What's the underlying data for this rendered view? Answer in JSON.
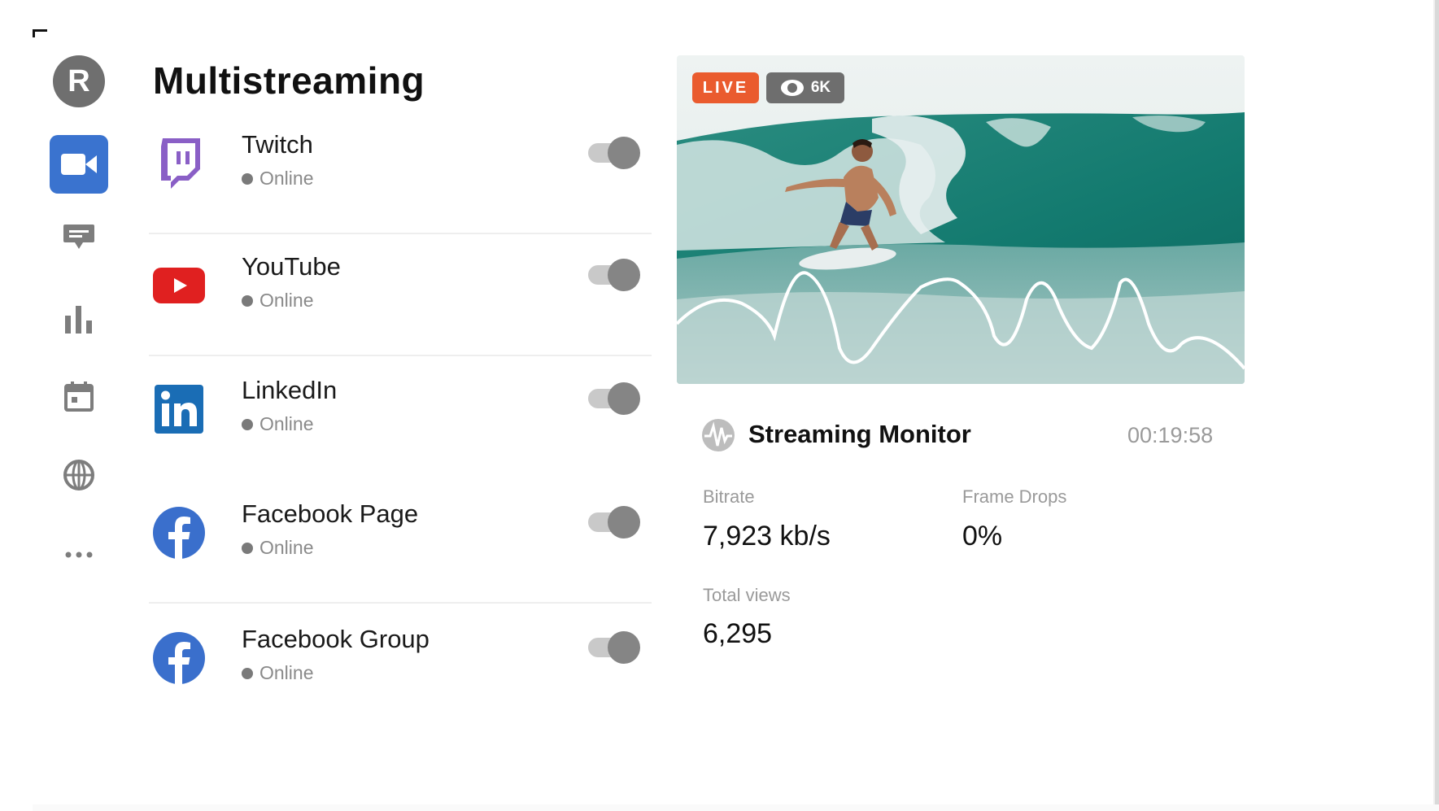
{
  "app": {
    "avatar_letter": "R",
    "title": "Multistreaming"
  },
  "sidebar": {
    "items": [
      {
        "name": "video-camera",
        "active": true
      },
      {
        "name": "chat"
      },
      {
        "name": "analytics"
      },
      {
        "name": "calendar"
      },
      {
        "name": "globe"
      },
      {
        "name": "more"
      }
    ]
  },
  "platforms": [
    {
      "name": "Twitch",
      "status": "Online",
      "enabled": true,
      "icon": "twitch-icon",
      "color": "#8a5fc6"
    },
    {
      "name": "YouTube",
      "status": "Online",
      "enabled": true,
      "icon": "youtube-icon",
      "color": "#e02020"
    },
    {
      "name": "LinkedIn",
      "status": "Online",
      "enabled": true,
      "icon": "linkedin-icon",
      "color": "#1a6db5"
    },
    {
      "name": "Facebook Page",
      "status": "Online",
      "enabled": true,
      "icon": "facebook-icon",
      "color": "#3a6fcc"
    },
    {
      "name": "Facebook Group",
      "status": "Online",
      "enabled": true,
      "icon": "facebook-icon",
      "color": "#3a6fcc"
    }
  ],
  "preview": {
    "live_label": "LIVE",
    "viewers_label": "6K",
    "live_color": "#ea5b2e"
  },
  "monitor": {
    "title": "Streaming Monitor",
    "elapsed": "00:19:58",
    "bitrate_label": "Bitrate",
    "bitrate_value": "7,923 kb/s",
    "frame_drops_label": "Frame Drops",
    "frame_drops_value": "0%",
    "total_views_label": "Total views",
    "total_views_value": "6,295"
  },
  "colors": {
    "accent": "#3a73cf",
    "toggle_knob": "#858585"
  }
}
